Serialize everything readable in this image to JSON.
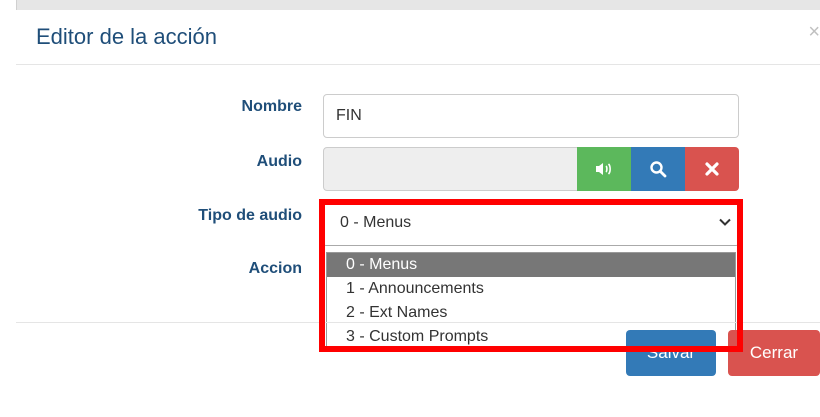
{
  "modal": {
    "title": "Editor de la acción",
    "close_glyph": "×"
  },
  "form": {
    "nombre": {
      "label": "Nombre",
      "value": "FIN"
    },
    "audio": {
      "label": "Audio",
      "value": "",
      "play_icon": "speaker-icon",
      "search_icon": "search-icon",
      "delete_icon": "close-icon"
    },
    "tipo_audio": {
      "label": "Tipo de audio",
      "selected": "0 - Menus",
      "options": [
        "0 - Menus",
        "1 - Announcements",
        "2 - Ext Names",
        "3 - Custom Prompts"
      ]
    },
    "accion": {
      "label": "Accion"
    }
  },
  "footer": {
    "save_label": "Salvar",
    "close_label": "Cerrar"
  },
  "colors": {
    "title": "#1f4e79",
    "success": "#5cb85c",
    "primary": "#337ab7",
    "danger": "#d9534f",
    "highlight": "#ff0000",
    "option_selected": "#777777"
  }
}
